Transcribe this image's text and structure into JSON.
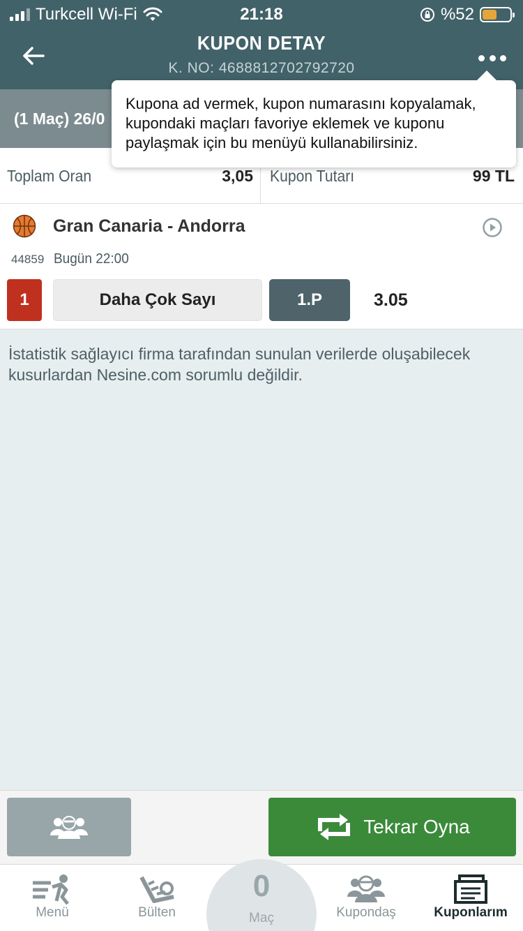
{
  "status_bar": {
    "carrier": "Turkcell Wi-Fi",
    "time": "21:18",
    "battery": "%52",
    "battery_level": 0.52
  },
  "header": {
    "title": "KUPON DETAY",
    "subtitle": "K. NO: 4688812702792720"
  },
  "summary": {
    "text": "(1 Maç) 26/0"
  },
  "tooltip": {
    "text": "Kupona ad vermek, kupon numarasını kopyalamak, kupondaki maçları favoriye eklemek ve kuponu paylaşmak için bu menüyü kullanabilirsiniz."
  },
  "totals": {
    "odds_label": "Toplam Oran",
    "odds_value": "3,05",
    "amount_label": "Kupon Tutarı",
    "amount_value": "99 TL"
  },
  "match": {
    "name": "Gran Canaria - Andorra",
    "code": "44859",
    "time": "Bugün 22:00",
    "pick_number": "1",
    "pick_name": "Daha Çok Sayı",
    "period": "1.P",
    "odd": "3.05"
  },
  "disclaimer": "İstatistik sağlayıcı firma tarafından sunulan verilerde oluşabilecek kusurlardan Nesine.com sorumlu değildir.",
  "actions": {
    "replay_label": "Tekrar Oyna"
  },
  "tabs": [
    {
      "label": "Menü",
      "icon": "menu-runner-icon"
    },
    {
      "label": "Bülten",
      "icon": "bulletin-icon"
    },
    {
      "label": "Maç",
      "count": "0"
    },
    {
      "label": "Kupondaş",
      "icon": "group-icon"
    },
    {
      "label": "Kuponlarım",
      "icon": "coupons-icon",
      "active": true
    }
  ],
  "colors": {
    "header": "#426269",
    "pick_red": "#c0301f",
    "replay_green": "#3a8a3a",
    "period_bg": "#4e636a"
  }
}
